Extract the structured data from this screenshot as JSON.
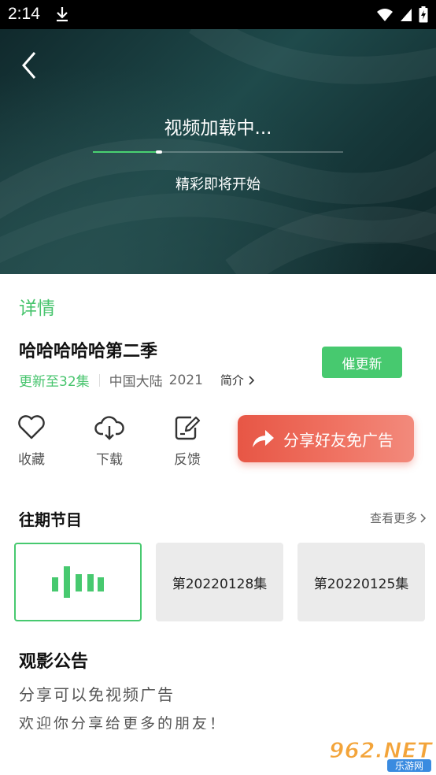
{
  "status_bar": {
    "time": "2:14"
  },
  "player": {
    "loading_title": "视频加载中...",
    "loading_subtitle": "精彩即将开始",
    "progress_fraction": 0.25
  },
  "detail": {
    "tab_label": "详情",
    "show_title": "哈哈哈哈哈第二季",
    "update_status": "更新至32集",
    "region": "中国大陆",
    "year": "2021",
    "intro_label": "简介",
    "urge_button": "催更新"
  },
  "actions": {
    "favorite": "收藏",
    "download": "下载",
    "feedback": "反馈",
    "share": "分享好友免广告"
  },
  "past_episodes": {
    "title": "往期节目",
    "more_label": "查看更多",
    "items": [
      "第20220128集",
      "第20220125集"
    ]
  },
  "notice": {
    "title": "观影公告",
    "line1": "分享可以免视频广告",
    "line2": "欢迎你分享给更多的朋友！"
  },
  "watermark": {
    "text": "962.NET",
    "sub": "乐游网"
  },
  "colors": {
    "accent": "#47c96f",
    "share": "#e75645",
    "player_bg": "#1f4a4b"
  }
}
